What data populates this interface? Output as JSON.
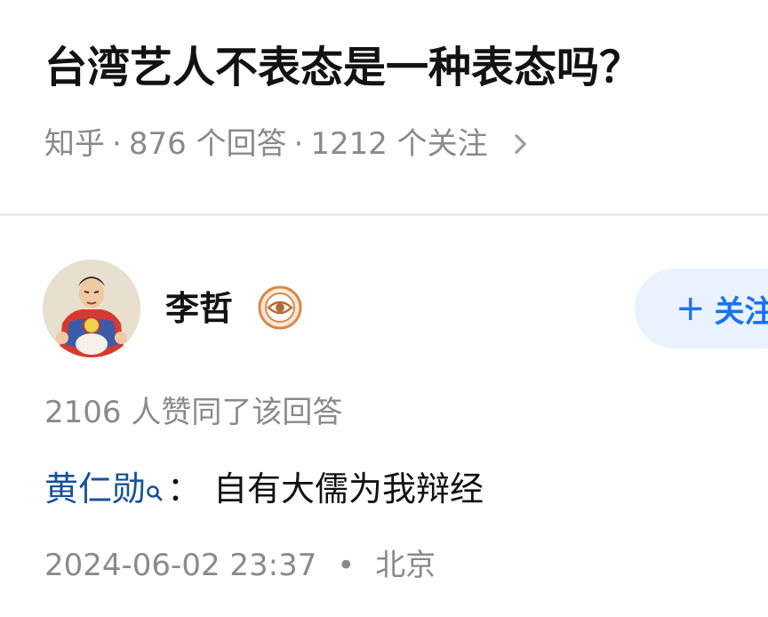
{
  "question": {
    "title": "台湾艺人不表态是一种表态吗？",
    "source": "知乎",
    "answers": "876 个回答",
    "followers": "1212 个关注"
  },
  "author": {
    "name": "李哲",
    "badge_icon": "eye-badge-icon",
    "follow_plus": "+",
    "follow_label": "关注"
  },
  "answer": {
    "vote_summary": "2106 人赞同了该回答",
    "mention": "黄仁勋",
    "colon": "：",
    "text": "自有大儒为我辩经",
    "time": "2024-06-02 23:37",
    "location": "北京"
  },
  "colors": {
    "accent": "#1772f6",
    "mention": "#175199",
    "muted": "#8a8a8a"
  }
}
